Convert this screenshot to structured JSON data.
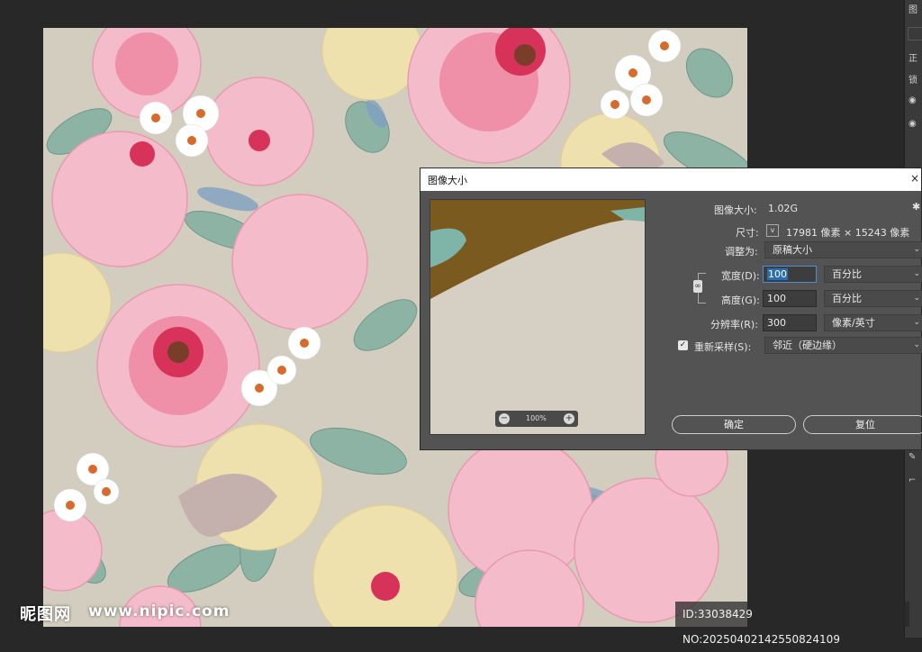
{
  "right_panel": {
    "top_label": "图",
    "labels": [
      "正",
      "锁"
    ]
  },
  "watermark": {
    "logo": "昵图网",
    "url": "www.nipic.com",
    "id_text": "ID:33038429 NO:20250402142550824109"
  },
  "dialog": {
    "title": "图像大小",
    "close": "×",
    "image_size_label": "图像大小:",
    "image_size_value": "1.02G",
    "gear": "✱",
    "dimensions_label": "尺寸:",
    "dimensions_value": "17981 像素 × 15243 像素",
    "fit_label": "调整为:",
    "fit_value": "原稿大小",
    "width_label": "宽度(D):",
    "width_value": "100",
    "width_unit": "百分比",
    "height_label": "高度(G):",
    "height_value": "100",
    "height_unit": "百分比",
    "resolution_label": "分辨率(R):",
    "resolution_value": "300",
    "resolution_unit": "像素/英寸",
    "resample_label": "重新采样(S):",
    "resample_value": "邻近（硬边缘）",
    "resample_checked": "✓",
    "zoom_level": "100%",
    "zoom_out": "−",
    "zoom_in": "+",
    "ok_label": "确定",
    "reset_label": "复位"
  },
  "colors": {
    "canvas_bg": "#d3cdbf",
    "rose_pink": "#f2b5c3",
    "rose_deep": "#d8365c",
    "leaf": "#8fb5a6",
    "cream": "#efe2b0",
    "highlight": "#2a6fb5"
  }
}
